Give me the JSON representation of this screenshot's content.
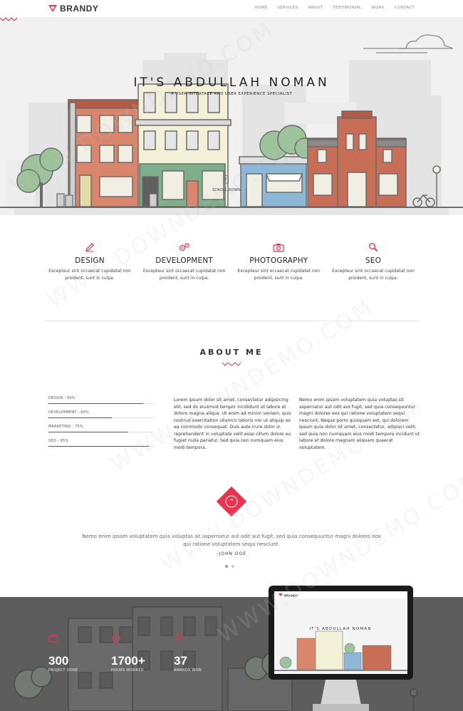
{
  "brand": {
    "name": "BRANDY",
    "accent": "#e8344e"
  },
  "nav": [
    "HOME",
    "SERVICES",
    "ABOUT",
    "TESTIMONIAL",
    "WORK",
    "CONTACT"
  ],
  "hero": {
    "title": "IT'S ABDULLAH NOMAN",
    "subtitle": "A USER INTERFACE AND USER EXPERIENCE SPECIALIST",
    "scroll_label": "SCROLL DOWN"
  },
  "services": [
    {
      "icon": "pencil-icon",
      "title": "DESIGN",
      "text": "Excepteur sint occaecat cupidatat non proident, sunt in culpa."
    },
    {
      "icon": "gears-icon",
      "title": "DEVELOPMENT",
      "text": "Excepteur sint occaecat cupidatat non proident, sunt in culpa."
    },
    {
      "icon": "camera-icon",
      "title": "PHOTOGRAPHY",
      "text": "Excepteur sint occaecat cupidatat non proident, sunt in culpa."
    },
    {
      "icon": "magnifier-icon",
      "title": "SEO",
      "text": "Excepteur sint occaecat cupidatat non proident, sunt in culpa."
    }
  ],
  "about": {
    "title": "ABOUT ME",
    "skills": [
      {
        "label": "DESIGN - 90%",
        "value": 0.9
      },
      {
        "label": "DEVELOPMENT - 60%",
        "value": 0.6
      },
      {
        "label": "MARKETING - 75%",
        "value": 0.75
      },
      {
        "label": "SEO - 95%",
        "value": 0.95
      }
    ],
    "col1": "Lorem ipsum dolor sit amet, consectetur adipisicing elit, sed do eiusmod tempor incididunt ut labore et dolore magna aliqua. Ut enim ad minim veniam, quis nostrud exercitation ullamco laboris nisi ut aliquip ex ea commodo consequat. Duis aute irure dolor in reprehenderit in voluptate velit esse cillum dolore eu fugiat nulla pariatur. Sed quia non numquam eius modi tempora.",
    "col2": "Nemo enim ipsam voluptatem quia voluptas sit aspernatur aut odit aut fugit, sed quia consequuntur magni dolores eos qui ratione voluptatem sequi nesciunt. Neque porro quisquam est, qui dolorem ipsum quia dolor sit amet, consectetur, adipisci velit, sed quia non numquam eius modi tempora incidunt ut labore et dolore magnam aliquam quaerat voluptatem."
  },
  "testimonial": {
    "quote": "Nemo enim ipsam voluptatem quia voluptas sit aspernatur aut odit aut fugit, sed quia consequuntur magni dolores eos qui ratione voluptatem sequi nesciunt.",
    "author": "-JOHN DOE",
    "slides": 2,
    "active_slide": 1
  },
  "stats": [
    {
      "icon": "briefcase-icon",
      "number": "300",
      "label": "PROJECT DONE"
    },
    {
      "icon": "clock-icon",
      "number": "1700+",
      "label": "HOURS WORKED"
    },
    {
      "icon": "trophy-icon",
      "number": "37",
      "label": "AWARDS WON"
    }
  ],
  "monitor": {
    "brand": "BRANDY",
    "title": "IT'S ABDULLAH NOMAN"
  },
  "watermarks": [
    "WWW.DOWNDEMO.COM",
    "WWW.DOWNDEMO.COM",
    "WWW.DOWNDEMO.COM",
    "WWW.DOWNDEMO.COM",
    "WWW.DOWNDEMO.COM"
  ]
}
